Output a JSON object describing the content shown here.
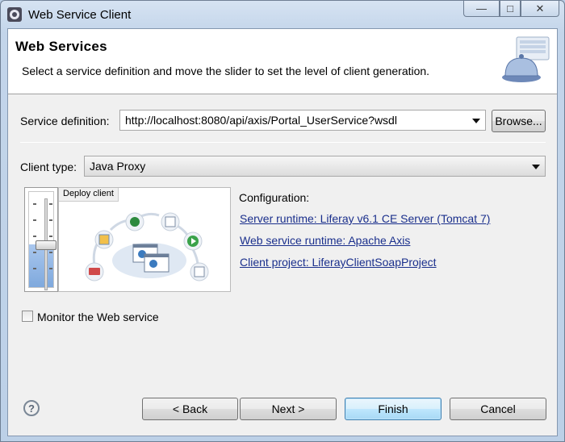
{
  "window": {
    "title": "Web Service Client",
    "controls": {
      "minimize": "—",
      "maximize": "□",
      "close": "✕"
    }
  },
  "banner": {
    "title": "Web Services",
    "description": "Select a service definition and move the slider to set the level of client generation."
  },
  "service_definition": {
    "label": "Service definition:",
    "value": "http://localhost:8080/api/axis/Portal_UserService?wsdl",
    "browse_label": "Browse..."
  },
  "client_type": {
    "label": "Client type:",
    "value": "Java Proxy"
  },
  "slider": {
    "preview_label": "Deploy client",
    "level_fraction": 0.45
  },
  "configuration": {
    "heading": "Configuration:",
    "server_runtime": "Server runtime: Liferay v6.1 CE Server (Tomcat 7)",
    "ws_runtime": "Web service runtime: Apache Axis",
    "client_project": "Client project: LiferayClientSoapProject"
  },
  "monitor": {
    "label": "Monitor the Web service",
    "checked": false
  },
  "footer": {
    "help": "?",
    "back": "< Back",
    "next": "Next >",
    "finish": "Finish",
    "cancel": "Cancel"
  },
  "colors": {
    "link": "#1a2f8c",
    "frame": "#c3d5ea",
    "slider_fill": "#7fa9dd"
  }
}
